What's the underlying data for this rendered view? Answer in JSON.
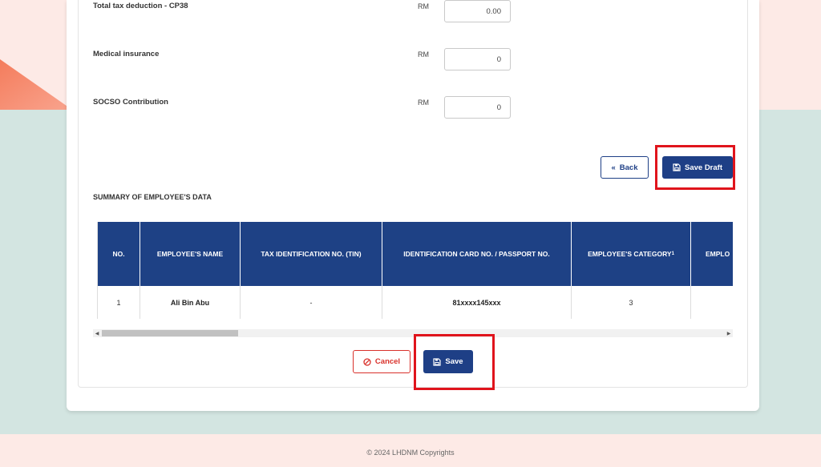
{
  "form": {
    "rows": [
      {
        "label": "Total tax deduction - CP38",
        "currency": "RM",
        "value": "0.00"
      },
      {
        "label": "Medical insurance",
        "currency": "RM",
        "value": "0"
      },
      {
        "label": "SOCSO Contribution",
        "currency": "RM",
        "value": "0"
      }
    ]
  },
  "actions": {
    "back_label": "Back",
    "save_draft_label": "Save Draft",
    "cancel_label": "Cancel",
    "save_label": "Save"
  },
  "summary": {
    "title": "SUMMARY OF EMPLOYEE'S DATA",
    "columns": [
      "NO.",
      "EMPLOYEE'S NAME",
      "TAX IDENTIFICATION NO. (TIN)",
      "IDENTIFICATION CARD NO. / PASSPORT NO.",
      "EMPLOYEE'S CATEGORY",
      "EMPLO"
    ],
    "category_footnote": "1",
    "rows": [
      {
        "no": "1",
        "name": "Ali Bin Abu",
        "tin": "-",
        "id": "81xxxx145xxx",
        "category": "3",
        "extra": ""
      }
    ]
  },
  "footer": {
    "copyright": "© 2024 LHDNM Copyrights"
  },
  "colors": {
    "primary": "#1e4185",
    "danger": "#d9312b",
    "highlight": "#e0141c",
    "bg_pink": "#fdeae6",
    "bg_mint": "#d3e5e1"
  }
}
